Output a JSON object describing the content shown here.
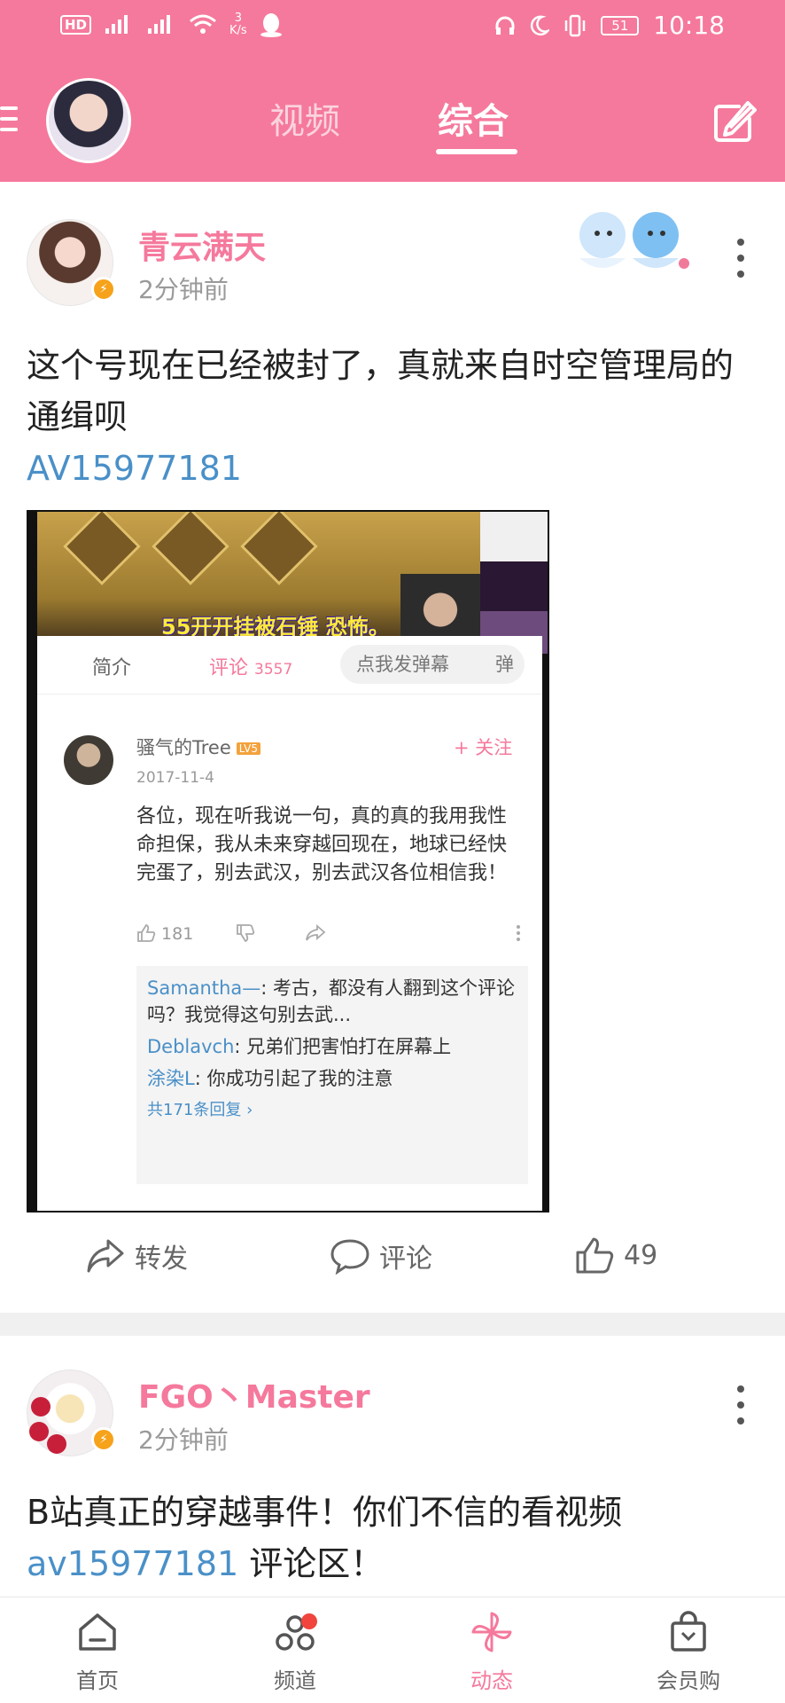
{
  "status_bar": {
    "network_label": "HD",
    "net_speed": "3",
    "net_speed_unit": "K/s",
    "battery": "51",
    "time": "10:18"
  },
  "top_nav": {
    "tabs": [
      {
        "label": "视频",
        "active": false
      },
      {
        "label": "综合",
        "active": true
      }
    ]
  },
  "posts": [
    {
      "username": "青云满天",
      "time_ago": "2分钟前",
      "text": "这个号现在已经被封了，真就来自时空管理局的通缉呗",
      "link": "AV15977181",
      "embedded_image": {
        "caption": "55开开挂被石锤 恐怖。",
        "tabs": {
          "intro": "简介",
          "comments": "评论",
          "comments_count": "3557"
        },
        "danmu_placeholder": "点我发弹幕",
        "danmu_button": "弹",
        "comment": {
          "user": "骚气的Tree",
          "level": "LV5",
          "follow_label": "+ 关注",
          "date": "2017-11-4",
          "body": "各位，现在听我说一句，真的真的我用我性命担保，我从未来穿越回现在，地球已经快完蛋了，别去武汉，别去武汉各位相信我！",
          "likes": "181"
        },
        "replies": [
          {
            "name": "Samantha—",
            "text": ": 考古，都没有人翻到这个评论吗？我觉得这句别去武..."
          },
          {
            "name": "Deblavch",
            "text": ": 兄弟们把害怕打在屏幕上"
          },
          {
            "name": "涂染L",
            "text": ": 你成功引起了我的注意"
          }
        ],
        "reply_count_label": "共171条回复 ›"
      },
      "actions": {
        "forward": "转发",
        "comment": "评论",
        "like_count": "49"
      }
    },
    {
      "username": "FGO丶Master",
      "time_ago": "2分钟前",
      "text_prefix": "B站真正的穿越事件！你们不信的看视频",
      "link": "av15977181",
      "text_suffix": " 评论区！"
    }
  ],
  "bottom_nav": [
    {
      "label": "首页",
      "icon": "home-icon"
    },
    {
      "label": "频道",
      "icon": "channel-icon",
      "has_dot": true
    },
    {
      "label": "动态",
      "icon": "pinwheel-icon",
      "active": true
    },
    {
      "label": "会员购",
      "icon": "shopping-bag-icon"
    }
  ],
  "colors": {
    "brand_pink": "#f5799c",
    "link_blue": "#4a90c8",
    "notification_red": "#f0443c"
  }
}
